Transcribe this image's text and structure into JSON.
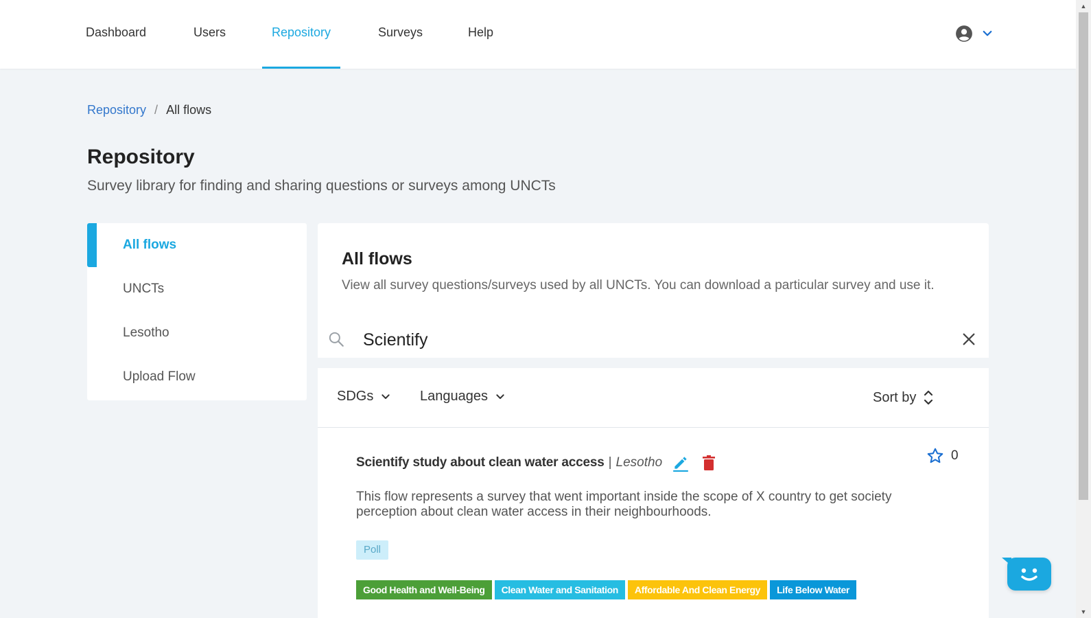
{
  "nav": {
    "items": [
      {
        "label": "Dashboard"
      },
      {
        "label": "Users"
      },
      {
        "label": "Repository"
      },
      {
        "label": "Surveys"
      },
      {
        "label": "Help"
      }
    ],
    "active": "Repository"
  },
  "breadcrumb": {
    "root": "Repository",
    "separator": "/",
    "current": "All flows"
  },
  "header": {
    "title": "Repository",
    "subtitle": "Survey library for finding and sharing questions or surveys among UNCTs"
  },
  "sidebar": {
    "items": [
      {
        "label": "All flows"
      },
      {
        "label": "UNCTs"
      },
      {
        "label": "Lesotho"
      },
      {
        "label": "Upload Flow"
      }
    ],
    "active": "All flows"
  },
  "main": {
    "title": "All flows",
    "description": "View all survey questions/surveys used by all UNCTs. You can download a particular survey and use it.",
    "search": {
      "value": "Scientify",
      "placeholder": ""
    },
    "filters": {
      "sdgs": "SDGs",
      "languages": "Languages",
      "sort": "Sort by"
    }
  },
  "flow": {
    "title": "Scientify study about clean water access",
    "separator": "|",
    "country": "Lesotho",
    "favorites": "0",
    "description": "This flow represents a survey that went important inside the scope of X country to get society perception about clean water access in their neighbourhoods.",
    "type": "Poll",
    "sdgs": [
      {
        "label": "Good Health and Well-Being",
        "color": "#4c9f38"
      },
      {
        "label": "Clean Water and Sanitation",
        "color": "#26bde2"
      },
      {
        "label": "Affordable And Clean Energy",
        "color": "#fcc30b"
      },
      {
        "label": "Life Below Water",
        "color": "#0a97d9"
      }
    ]
  },
  "colors": {
    "accent": "#1ba8e0",
    "link": "#3377cc",
    "delete": "#d32f2f"
  },
  "icons": {
    "user": "user-circle-icon",
    "chevron": "chevron-down-icon",
    "search": "search-icon",
    "clear": "close-icon",
    "sort": "sort-icon",
    "edit": "pencil-icon",
    "delete": "trash-icon",
    "favorite": "star-icon",
    "chat": "chat-bot-icon"
  }
}
